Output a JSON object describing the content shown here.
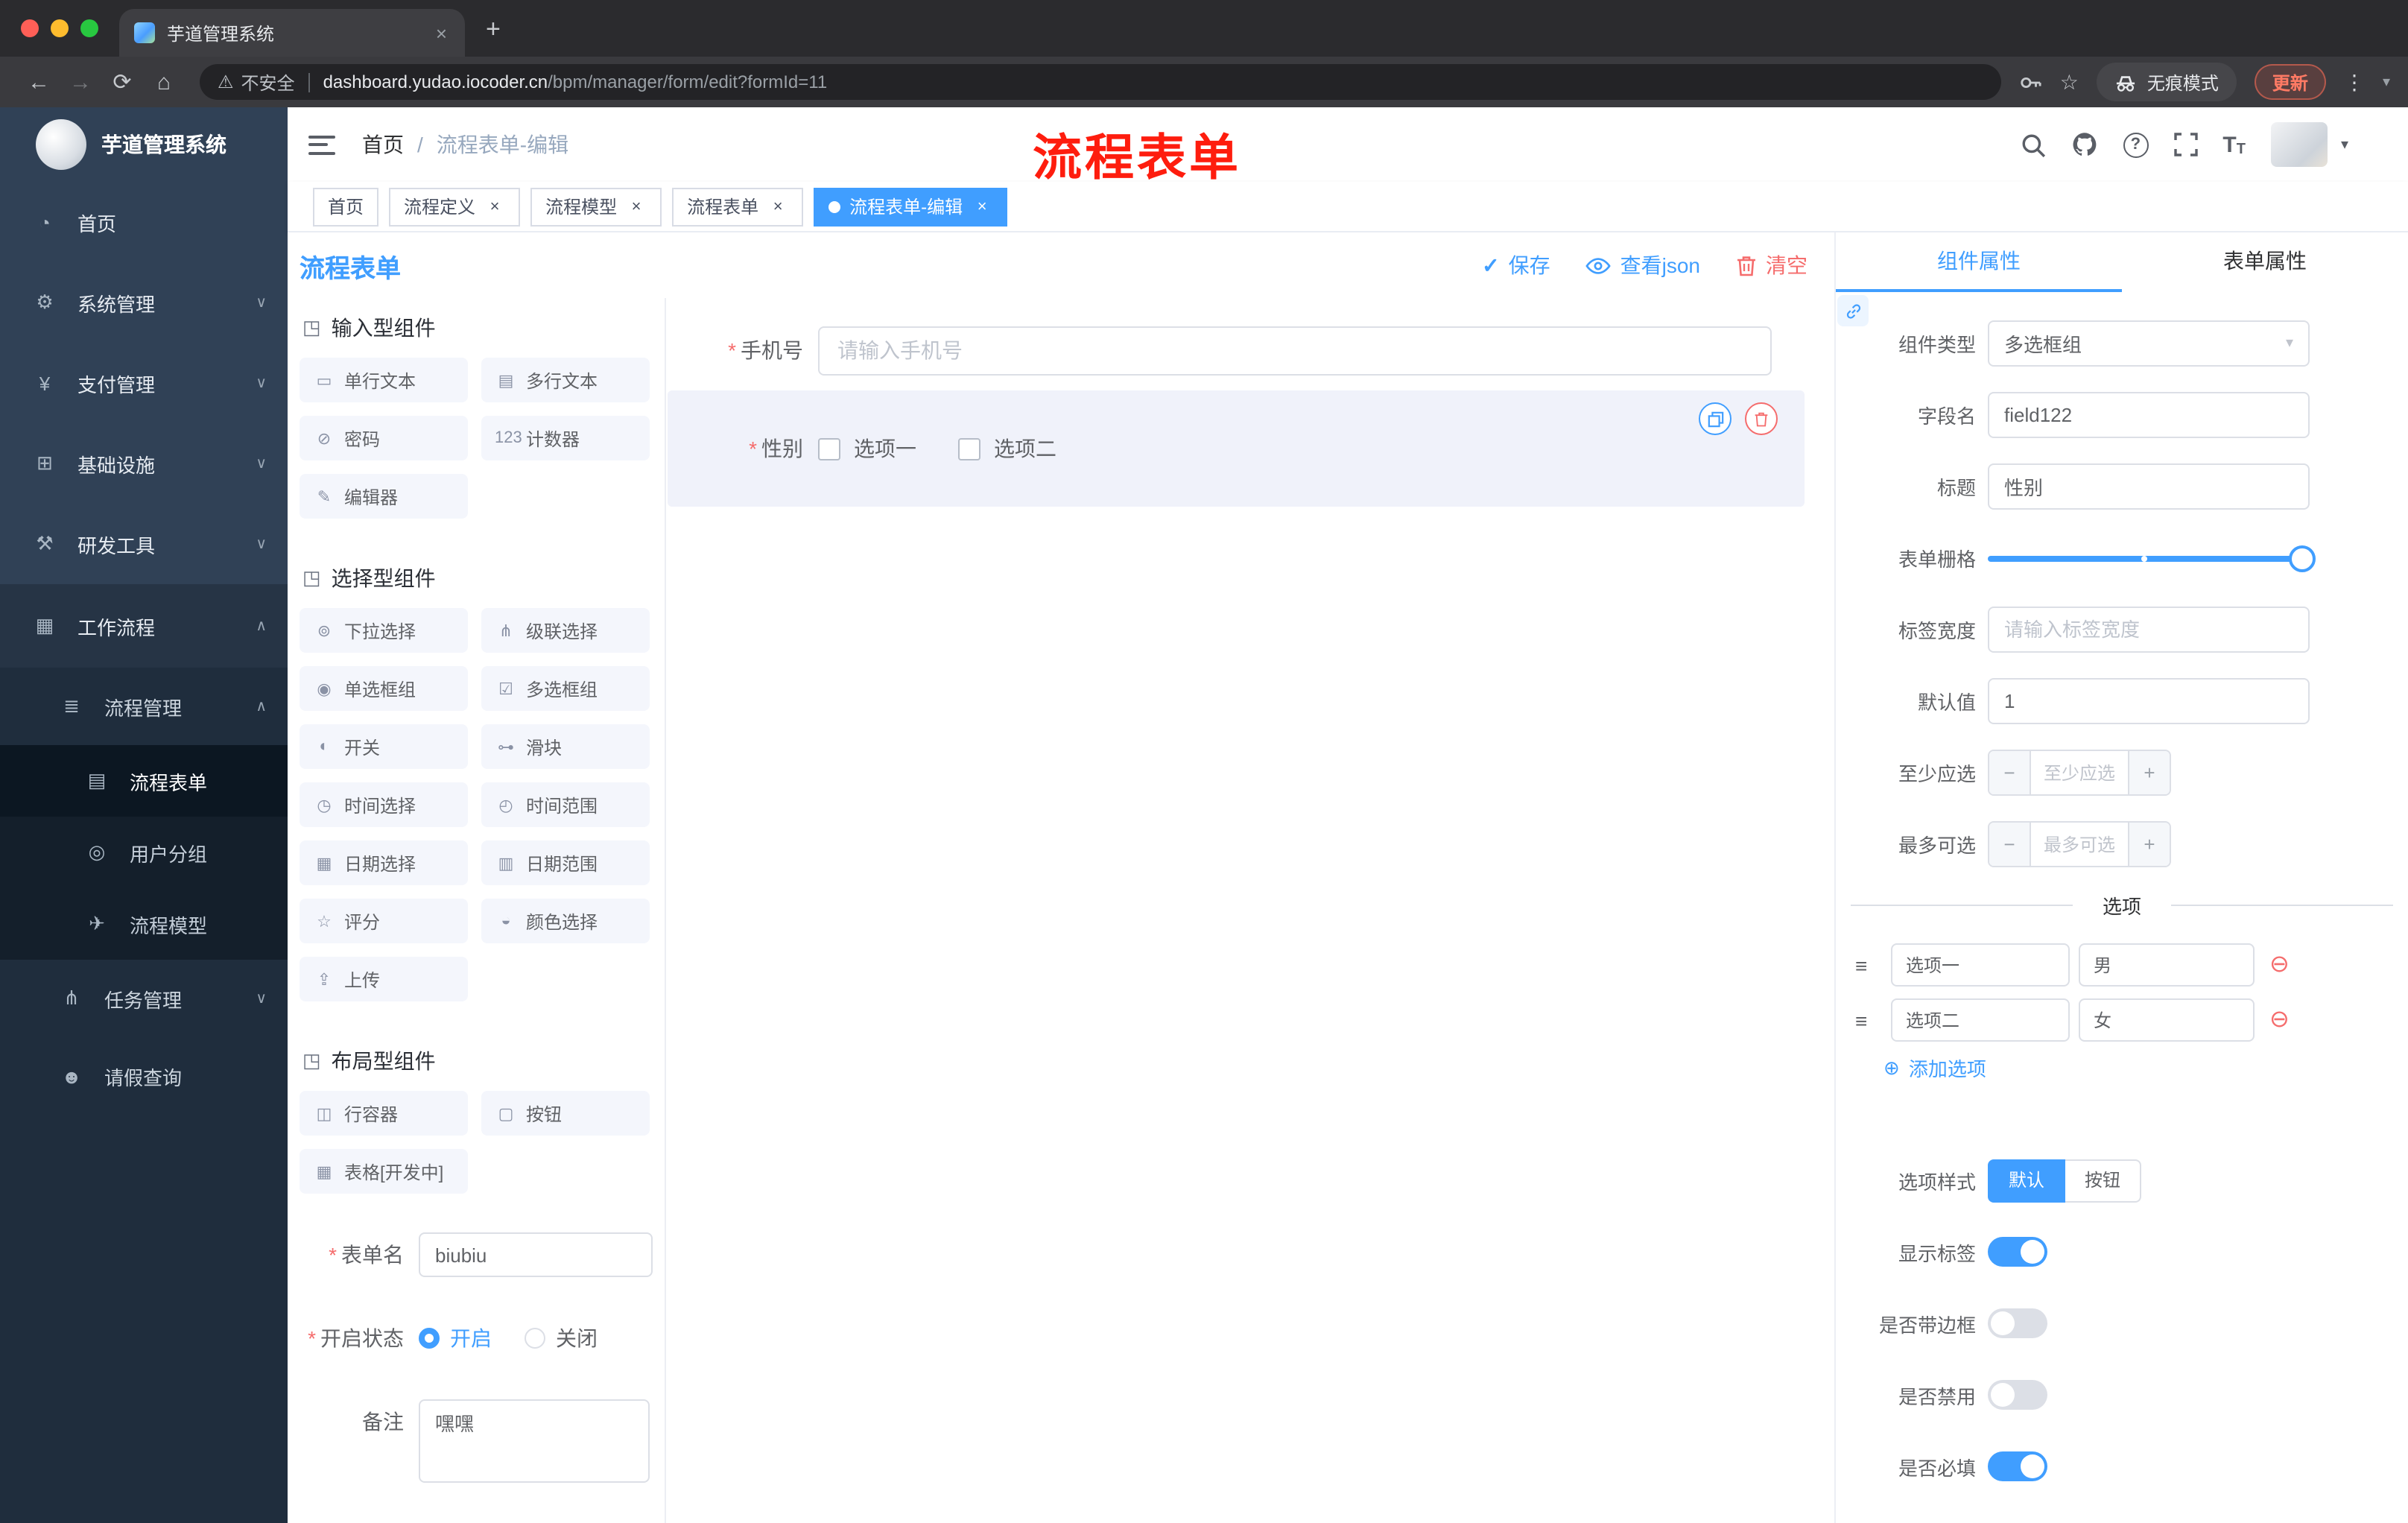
{
  "icons": {
    "close": "×",
    "newtab": "+",
    "back": "←",
    "forward": "→",
    "reload": "⟳",
    "home": "⌂",
    "warning": "⚠",
    "star": "☆",
    "dots": "⋮",
    "caret": "▾",
    "slash": "/",
    "question": "?",
    "check": "✓",
    "letter_T": "T",
    "asterisk": "*",
    "add_circle": "⊕",
    "remove_circle": "⊖",
    "minus": "−",
    "plus": "+",
    "drag": "≡",
    "chevron_down": "∨",
    "chevron_up": "∧",
    "dot": "●"
  },
  "browser": {
    "tab_title": "芋道管理系统",
    "security_label": "不安全",
    "url_host": "dashboard.yudao.iocoder.cn",
    "url_path": "/bpm/manager/form/edit?formId=11",
    "incognito_label": "无痕模式",
    "update_label": "更新"
  },
  "sidebar": {
    "app_title": "芋道管理系统",
    "items": [
      {
        "icon": "◔",
        "label": "首页"
      },
      {
        "icon": "⚙",
        "label": "系统管理",
        "arrow": "∨"
      },
      {
        "icon": "¥",
        "label": "支付管理",
        "arrow": "∨"
      },
      {
        "icon": "⊞",
        "label": "基础设施",
        "arrow": "∨"
      },
      {
        "icon": "⚒",
        "label": "研发工具",
        "arrow": "∨"
      },
      {
        "icon": "▦",
        "label": "工作流程",
        "arrow": "∧"
      },
      {
        "icon": "≣",
        "label": "流程管理",
        "arrow": "∧"
      },
      {
        "icon": "▤",
        "label": "流程表单"
      },
      {
        "icon": "◎",
        "label": "用户分组"
      },
      {
        "icon": "✈",
        "label": "流程模型"
      },
      {
        "icon": "⋔",
        "label": "任务管理",
        "arrow": "∨"
      },
      {
        "icon": "☻",
        "label": "请假查询"
      }
    ]
  },
  "navbar": {
    "breadcrumb_home": "首页",
    "breadcrumb_current": "流程表单-编辑",
    "annotation": "流程表单"
  },
  "tags": [
    {
      "label": "首页"
    },
    {
      "label": "流程定义"
    },
    {
      "label": "流程模型"
    },
    {
      "label": "流程表单"
    },
    {
      "label": "流程表单-编辑"
    }
  ],
  "designer": {
    "title": "流程表单",
    "actions": {
      "save": "保存",
      "view_json": "查看json",
      "clear": "清空"
    },
    "groups": [
      {
        "title": "输入型组件",
        "icon": "◳",
        "items": [
          {
            "icon": "▭",
            "label": "单行文本"
          },
          {
            "icon": "▤",
            "label": "多行文本"
          },
          {
            "icon": "⊘",
            "label": "密码"
          },
          {
            "icon": "123",
            "label": "计数器"
          },
          {
            "icon": "✎",
            "label": "编辑器"
          }
        ]
      },
      {
        "title": "选择型组件",
        "icon": "◳",
        "items": [
          {
            "icon": "⊚",
            "label": "下拉选择"
          },
          {
            "icon": "⋔",
            "label": "级联选择"
          },
          {
            "icon": "◉",
            "label": "单选框组"
          },
          {
            "icon": "☑",
            "label": "多选框组"
          },
          {
            "icon": "◐",
            "label": "开关"
          },
          {
            "icon": "⊶",
            "label": "滑块"
          },
          {
            "icon": "◷",
            "label": "时间选择"
          },
          {
            "icon": "◴",
            "label": "时间范围"
          },
          {
            "icon": "▦",
            "label": "日期选择"
          },
          {
            "icon": "▥",
            "label": "日期范围"
          },
          {
            "icon": "☆",
            "label": "评分"
          },
          {
            "icon": "◒",
            "label": "颜色选择"
          },
          {
            "icon": "⇪",
            "label": "上传"
          }
        ]
      },
      {
        "title": "布局型组件",
        "icon": "◳",
        "items": [
          {
            "icon": "◫",
            "label": "行容器"
          },
          {
            "icon": "▢",
            "label": "按钮"
          },
          {
            "icon": "▦",
            "label": "表格[开发中]"
          }
        ]
      }
    ],
    "form": {
      "name_label": "表单名",
      "name_value": "biubiu",
      "status_label": "开启状态",
      "status_on": "开启",
      "status_off": "关闭",
      "remark_label": "备注",
      "remark_value": "嘿嘿"
    }
  },
  "canvas": {
    "phone_label": "手机号",
    "phone_placeholder": "请输入手机号",
    "gender_label": "性别",
    "option1": "选项一",
    "option2": "选项二"
  },
  "props": {
    "tab_component": "组件属性",
    "tab_form": "表单属性",
    "type_label": "组件类型",
    "type_value": "多选框组",
    "field_label": "字段名",
    "field_value": "field122",
    "title_label": "标题",
    "title_value": "性别",
    "grid_label": "表单栅格",
    "width_label": "标签宽度",
    "width_placeholder": "请输入标签宽度",
    "default_label": "默认值",
    "default_value": "1",
    "min_label": "至少应选",
    "min_placeholder": "至少应选",
    "max_label": "最多可选",
    "max_placeholder": "最多可选",
    "options_title": "选项",
    "options": [
      {
        "label": "选项一",
        "value": "男"
      },
      {
        "label": "选项二",
        "value": "女"
      }
    ],
    "add_option": "添加选项",
    "style_label": "选项样式",
    "style_default": "默认",
    "style_button": "按钮",
    "show_label_label": "显示标签",
    "border_label": "是否带边框",
    "disabled_label": "是否禁用",
    "required_label": "是否必填"
  }
}
